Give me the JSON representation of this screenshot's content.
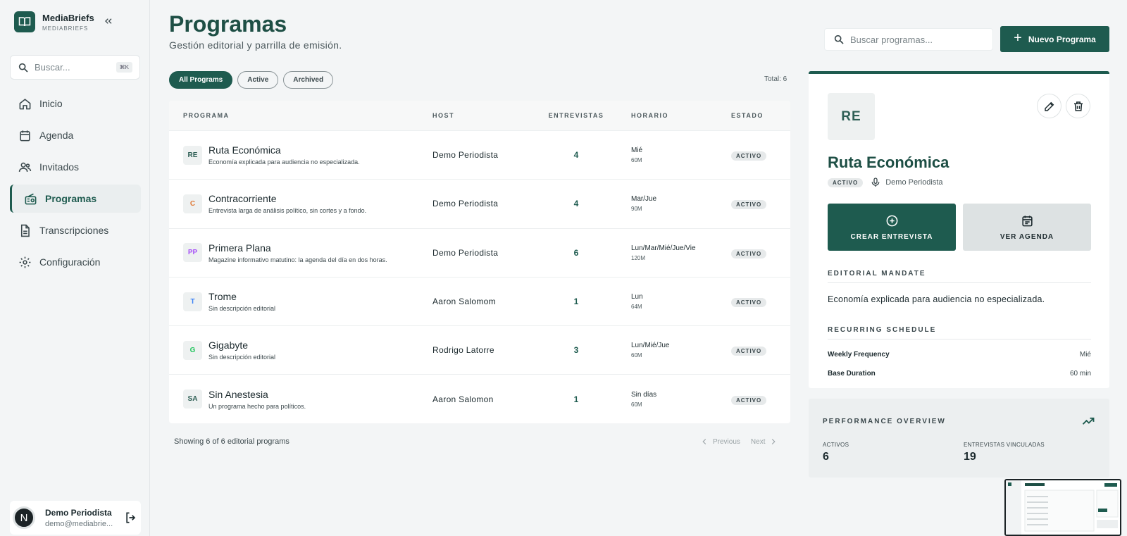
{
  "app": {
    "name": "MediaBriefs",
    "subtitle": "MEDIABRIEFS"
  },
  "sidebar": {
    "search_placeholder": "Buscar...",
    "shortcut": "⌘K",
    "items": [
      {
        "label": "Inicio",
        "icon": "home-icon"
      },
      {
        "label": "Agenda",
        "icon": "calendar-icon"
      },
      {
        "label": "Invitados",
        "icon": "users-icon"
      },
      {
        "label": "Programas",
        "icon": "radio-icon",
        "active": true
      },
      {
        "label": "Transcripciones",
        "icon": "document-icon"
      },
      {
        "label": "Configuración",
        "icon": "gear-icon"
      }
    ],
    "user": {
      "initial": "N",
      "name": "Demo Periodista",
      "email": "demo@mediabrie..."
    }
  },
  "header": {
    "title": "Programas",
    "subtitle": "Gestión editorial y parrilla de emisión.",
    "search_placeholder": "Buscar programas...",
    "new_button": "Nuevo Programa"
  },
  "filters": {
    "chips": [
      "All Programs",
      "Active",
      "Archived"
    ],
    "active": "All Programs",
    "total": "Total: 6"
  },
  "table": {
    "columns": [
      "PROGRAMA",
      "HOST",
      "ENTREVISTAS",
      "HORARIO",
      "ESTADO"
    ],
    "rows": [
      {
        "initials": "RE",
        "color": "#2e5f55",
        "name": "Ruta Económica",
        "desc": "Economía explicada para audiencia no especializada.",
        "host": "Demo Periodista",
        "interviews": "4",
        "days": "Mié",
        "duration": "60M",
        "status": "ACTIVO"
      },
      {
        "initials": "C",
        "color": "#e07b39",
        "name": "Contracorriente",
        "desc": "Entrevista larga de análisis político, sin cortes y a fondo.",
        "host": "Demo Periodista",
        "interviews": "4",
        "days": "Mar/Jue",
        "duration": "90M",
        "status": "ACTIVO"
      },
      {
        "initials": "PP",
        "color": "#a855f7",
        "name": "Primera Plana",
        "desc": "Magazine informativo matutino: la agenda del día en dos horas.",
        "host": "Demo Periodista",
        "interviews": "6",
        "days": "Lun/Mar/Mié/Jue/Vie",
        "duration": "120M",
        "status": "ACTIVO"
      },
      {
        "initials": "T",
        "color": "#3b82f6",
        "name": "Trome",
        "desc": "Sin descripción editorial",
        "host": "Aaron Salomom",
        "interviews": "1",
        "days": "Lun",
        "duration": "64M",
        "status": "ACTIVO"
      },
      {
        "initials": "G",
        "color": "#22c55e",
        "name": "Gigabyte",
        "desc": "Sin descripción editorial",
        "host": "Rodrigo Latorre",
        "interviews": "3",
        "days": "Lun/Mié/Jue",
        "duration": "60M",
        "status": "ACTIVO"
      },
      {
        "initials": "SA",
        "color": "#2e5f55",
        "name": "Sin Anestesia",
        "desc": "Un programa hecho para políticos.",
        "host": "Aaron Salomon",
        "interviews": "1",
        "days": "Sin días",
        "duration": "60M",
        "status": "ACTIVO"
      }
    ],
    "showing": "Showing 6 of 6 editorial programs",
    "prev": "Previous",
    "next": "Next"
  },
  "detail": {
    "initials": "RE",
    "title": "Ruta Económica",
    "status": "ACTIVO",
    "host": "Demo Periodista",
    "create_button": "CREAR ENTREVISTA",
    "agenda_button": "VER AGENDA",
    "mandate_label": "EDITORIAL MANDATE",
    "mandate": "Economía explicada para audiencia no especializada.",
    "schedule_label": "RECURRING SCHEDULE",
    "frequency_label": "Weekly Frequency",
    "frequency": "Mié",
    "duration_label": "Base Duration",
    "duration": "60 min"
  },
  "performance": {
    "title": "PERFORMANCE OVERVIEW",
    "active_label": "ACTIVOS",
    "active_value": "6",
    "linked_label": "ENTREVISTAS VINCULADAS",
    "linked_value": "19"
  },
  "colors": {
    "brand": "#1e5b4f",
    "background": "#f3f5f6"
  }
}
